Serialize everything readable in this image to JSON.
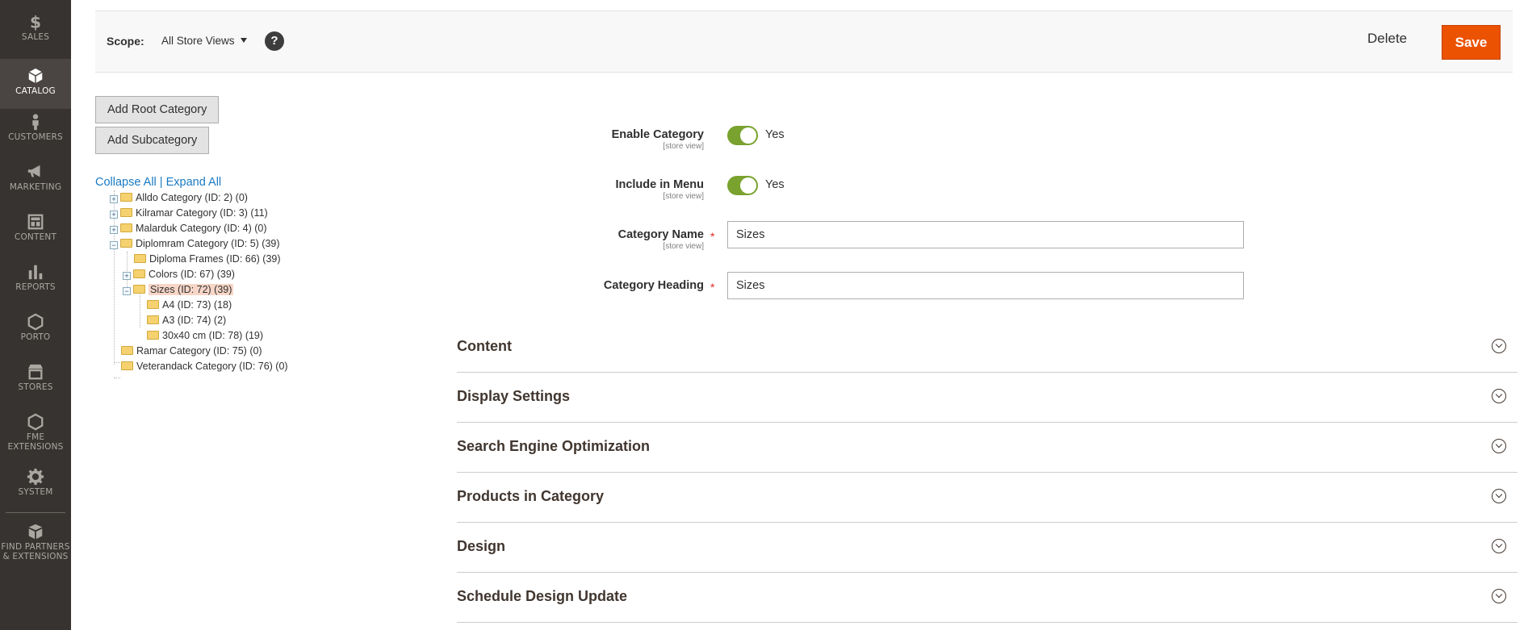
{
  "sidebar": {
    "items": [
      {
        "label": "SALES",
        "icon": "dollar-icon"
      },
      {
        "label": "CATALOG",
        "icon": "cube-icon",
        "active": true
      },
      {
        "label": "CUSTOMERS",
        "icon": "person-icon"
      },
      {
        "label": "MARKETING",
        "icon": "megaphone-icon"
      },
      {
        "label": "CONTENT",
        "icon": "layout-icon"
      },
      {
        "label": "REPORTS",
        "icon": "bar-chart-icon"
      },
      {
        "label": "PORTO",
        "icon": "hexagon-icon"
      },
      {
        "label": "STORES",
        "icon": "store-icon"
      },
      {
        "label_line1": "FME",
        "label_line2": "EXTENSIONS",
        "icon": "hexagon-icon"
      },
      {
        "label": "SYSTEM",
        "icon": "gear-icon"
      },
      {
        "label_line1": "FIND PARTNERS",
        "label_line2": "& EXTENSIONS",
        "icon": "boxes-icon"
      }
    ]
  },
  "header": {
    "scope_label": "Scope:",
    "scope_value": "All Store Views",
    "help": "?",
    "delete_label": "Delete",
    "save_label": "Save"
  },
  "tree_panel": {
    "add_root_label": "Add Root Category",
    "add_sub_label": "Add Subcategory",
    "collapse_all": "Collapse All",
    "separator": "|",
    "expand_all": "Expand All",
    "nodes": [
      {
        "label": "Alldo Category (ID: 2) (0)",
        "expander": "+"
      },
      {
        "label": "Kilramar Category (ID: 3) (11)",
        "expander": "+"
      },
      {
        "label": "Malarduk Category (ID: 4) (0)",
        "expander": "+"
      },
      {
        "label": "Diplomram Category (ID: 5) (39)",
        "expander": "−"
      },
      {
        "label": "Diploma Frames (ID: 66) (39)",
        "expander": ""
      },
      {
        "label": "Colors (ID: 67) (39)",
        "expander": "+"
      },
      {
        "label": "Sizes (ID: 72) (39)",
        "expander": "−",
        "selected": true
      },
      {
        "label": "A4 (ID: 73) (18)",
        "expander": ""
      },
      {
        "label": "A3 (ID: 74) (2)",
        "expander": ""
      },
      {
        "label": "30x40 cm (ID: 78) (19)",
        "expander": ""
      },
      {
        "label": "Ramar Category (ID: 75) (0)",
        "expander": ""
      },
      {
        "label": "Veterandack Category (ID: 76) (0)",
        "expander": ""
      }
    ]
  },
  "form": {
    "enable_category": {
      "label": "Enable Category",
      "scope": "[store view]",
      "value": "Yes",
      "on": true
    },
    "include_in_menu": {
      "label": "Include in Menu",
      "scope": "[store view]",
      "value": "Yes",
      "on": true
    },
    "category_name": {
      "label": "Category Name",
      "scope": "[store view]",
      "value": "Sizes",
      "required": "*"
    },
    "category_heading": {
      "label": "Category Heading",
      "value": "Sizes",
      "required": "*"
    }
  },
  "sections": [
    {
      "title": "Content"
    },
    {
      "title": "Display Settings"
    },
    {
      "title": "Search Engine Optimization"
    },
    {
      "title": "Products in Category"
    },
    {
      "title": "Design"
    },
    {
      "title": "Schedule Design Update"
    }
  ],
  "colors": {
    "sidebar_bg": "#373330",
    "save_button": "#eb5202",
    "toggle_on": "#79a22e",
    "link": "#1979c3",
    "required": "#e22626"
  }
}
